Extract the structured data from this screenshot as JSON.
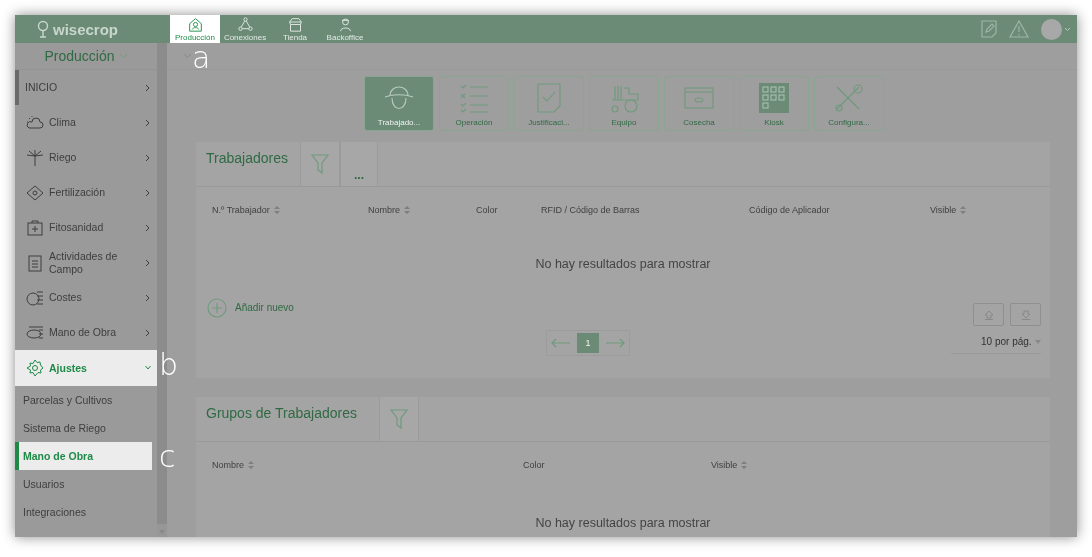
{
  "app": {
    "logo": "wisecrop"
  },
  "nav_tabs": [
    {
      "label": "Producción",
      "selected": true,
      "highlighted": true,
      "callout": "a"
    },
    {
      "label": "Conexiones",
      "selected": false,
      "highlighted": false
    },
    {
      "label": "Tienda",
      "selected": false,
      "highlighted": false
    },
    {
      "label": "Backoffice",
      "selected": false,
      "highlighted": false
    }
  ],
  "sidebar": {
    "title": "Producción",
    "items": [
      {
        "label": "INICIO",
        "selected": true,
        "highlighted": false
      },
      {
        "label": "Clima",
        "selected": false,
        "highlighted": false
      },
      {
        "label": "Riego",
        "selected": false,
        "highlighted": false
      },
      {
        "label": "Fertilización",
        "selected": false,
        "highlighted": false
      },
      {
        "label": "Fitosanidad",
        "selected": false,
        "highlighted": false
      },
      {
        "label": "Actividades de Campo",
        "selected": false,
        "highlighted": false
      },
      {
        "label": "Costes",
        "selected": false,
        "highlighted": false
      },
      {
        "label": "Mano de Obra",
        "selected": false,
        "highlighted": false
      },
      {
        "label": "Ajustes",
        "selected": false,
        "highlighted": true,
        "expanded": true,
        "callout": "b",
        "children": [
          {
            "label": "Parcelas y Cultivos",
            "selected": false,
            "highlighted": false
          },
          {
            "label": "Sistema de Riego",
            "selected": false,
            "highlighted": false
          },
          {
            "label": "Mano de Obra",
            "selected": true,
            "highlighted": true,
            "callout": "c"
          },
          {
            "label": "Usuarios",
            "selected": false,
            "highlighted": false
          },
          {
            "label": "Integraciones",
            "selected": false,
            "highlighted": false
          }
        ]
      }
    ]
  },
  "modules": [
    {
      "label": "Trabajado...",
      "selected": true
    },
    {
      "label": "Operación",
      "selected": false
    },
    {
      "label": "Justificaci...",
      "selected": false
    },
    {
      "label": "Equipo",
      "selected": false
    },
    {
      "label": "Cosecha",
      "selected": false
    },
    {
      "label": "Kiosk",
      "selected": false
    },
    {
      "label": "Configura...",
      "selected": false
    }
  ],
  "workers_table": {
    "title": "Trabajadores",
    "more": "...",
    "columns": [
      {
        "label": "N.º Trabajador",
        "sortable": true
      },
      {
        "label": "Nombre",
        "sortable": true
      },
      {
        "label": "Color",
        "sortable": false
      },
      {
        "label": "RFID / Código de Barras",
        "sortable": false
      },
      {
        "label": "Código de Aplicador",
        "sortable": false
      },
      {
        "label": "Visible",
        "sortable": true
      }
    ],
    "empty": "No hay resultados para mostrar",
    "add": "Añadir nuevo",
    "pages": [
      {
        "label": "1",
        "selected": true
      }
    ],
    "per_page": "10 por pág."
  },
  "groups_table": {
    "title": "Grupos de Trabajadores",
    "columns": [
      {
        "label": "Nombre",
        "sortable": true
      },
      {
        "label": "Color",
        "sortable": false
      },
      {
        "label": "Visible",
        "sortable": true
      }
    ],
    "empty": "No hay resultados para mostrar"
  }
}
